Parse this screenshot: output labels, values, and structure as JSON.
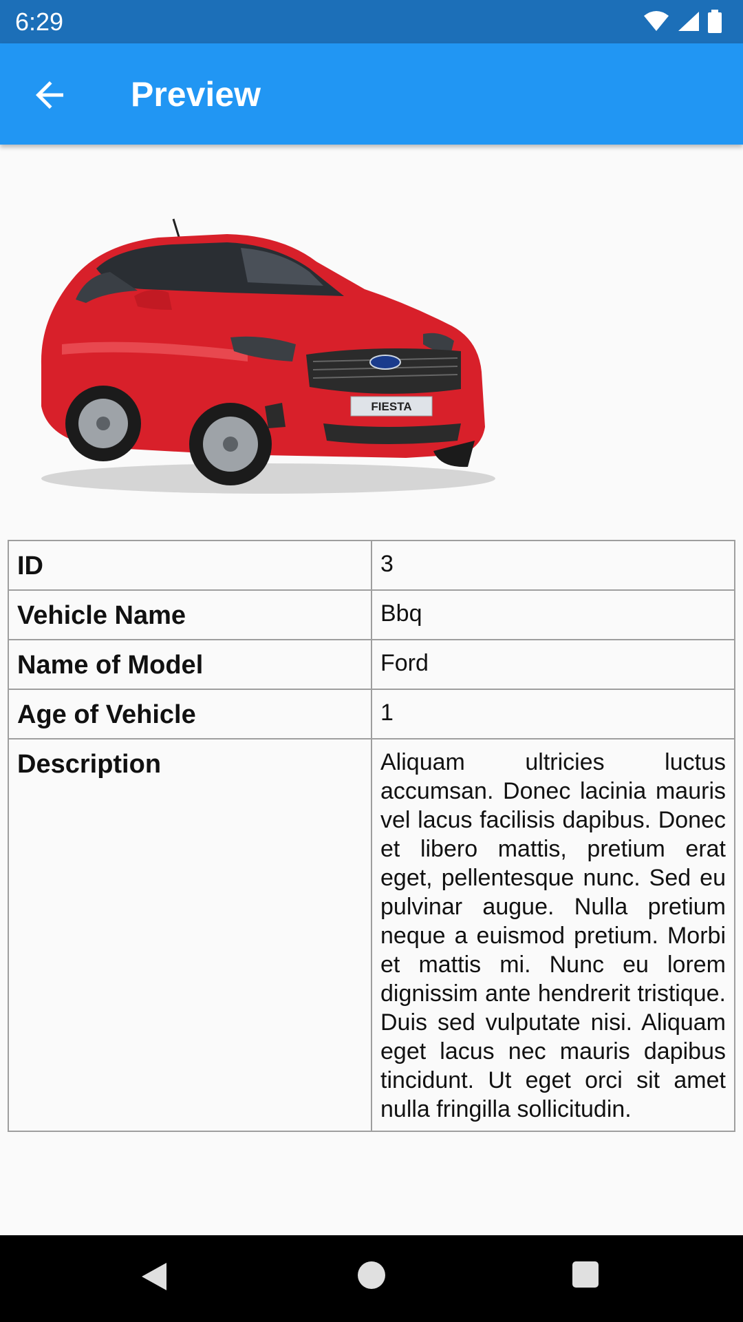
{
  "status_bar": {
    "time": "6:29"
  },
  "app_bar": {
    "title": "Preview",
    "back_icon": "arrow-back-icon"
  },
  "image": {
    "alt": "car-image",
    "plate": "FIESTA"
  },
  "details": {
    "rows": [
      {
        "key": "ID",
        "value": "3"
      },
      {
        "key": "Vehicle Name",
        "value": "Bbq"
      },
      {
        "key": "Name of Model",
        "value": "Ford"
      },
      {
        "key": "Age of Vehicle",
        "value": "1"
      },
      {
        "key": "Description",
        "value": "Aliquam ultricies luctus accumsan. Donec lacinia mauris vel lacus facilisis dapibus. Donec et libero mattis, pretium erat eget, pellentesque nunc. Sed eu pulvinar augue. Nulla pretium neque a euismod pretium. Morbi et mattis mi. Nunc eu lorem dignissim ante hendrerit tristique. Duis sed vulputate nisi. Aliquam eget lacus nec mauris dapibus tincidunt. Ut eget orci sit amet nulla fringilla sollicitudin."
      }
    ]
  },
  "colors": {
    "status_bar": "#1c6fb8",
    "app_bar": "#2196f3",
    "car": "#d8202a"
  }
}
